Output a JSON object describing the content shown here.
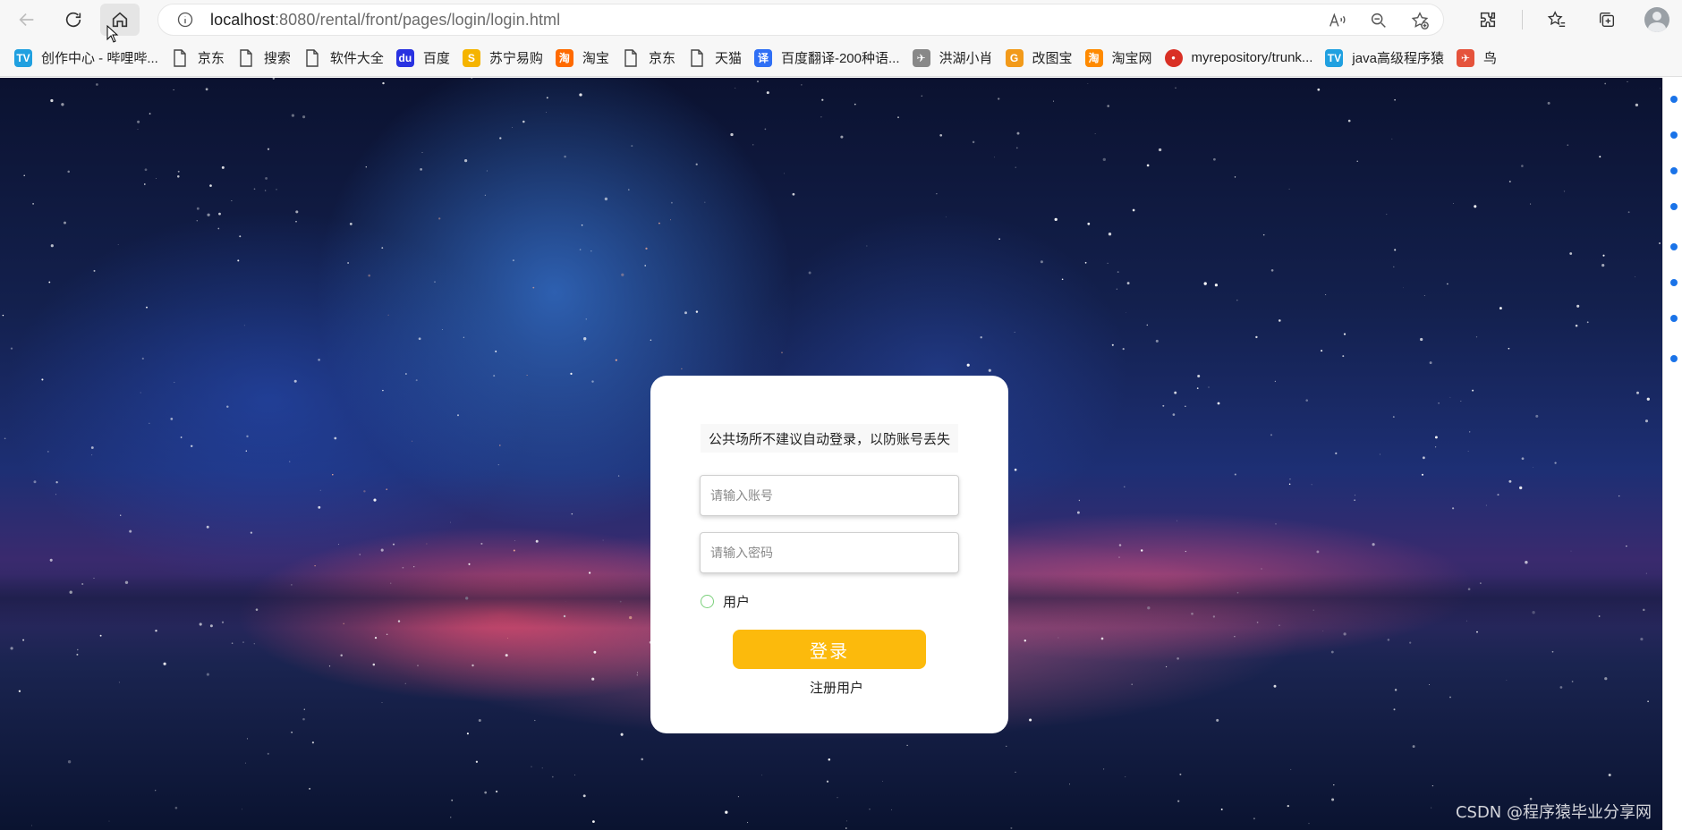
{
  "browser": {
    "url_host": "localhost",
    "url_rest": ":8080/rental/front/pages/login/login.html"
  },
  "bookmarks": [
    {
      "label": "创作中心 - 哔哩哔...",
      "icon": "bilibili-icon",
      "color": "#20a0e0"
    },
    {
      "label": "京东",
      "icon": "page-icon"
    },
    {
      "label": "搜索",
      "icon": "page-icon"
    },
    {
      "label": "软件大全",
      "icon": "page-icon"
    },
    {
      "label": "百度",
      "icon": "baidu-icon",
      "color": "#2932e1"
    },
    {
      "label": "苏宁易购",
      "icon": "suning-icon",
      "color": "#f5b400"
    },
    {
      "label": "淘宝",
      "icon": "taobao-icon",
      "color": "#ff6a00"
    },
    {
      "label": "京东",
      "icon": "page-icon"
    },
    {
      "label": "天猫",
      "icon": "page-icon"
    },
    {
      "label": "百度翻译-200种语...",
      "icon": "translate-icon",
      "color": "#2f6ff5"
    },
    {
      "label": "洪湖小肖",
      "icon": "bird-icon",
      "color": "#888888"
    },
    {
      "label": "改图宝",
      "icon": "gaitubao-icon",
      "color": "#f29a1a"
    },
    {
      "label": "淘宝网",
      "icon": "taobao-icon",
      "color": "#ff8a00"
    },
    {
      "label": "myrepository/trunk...",
      "icon": "chrome-icon",
      "color": "#d93025"
    },
    {
      "label": "java高级程序猿",
      "icon": "bilibili-icon",
      "color": "#20a0e0"
    },
    {
      "label": "鸟",
      "icon": "bird-icon",
      "color": "#e5533c"
    }
  ],
  "login": {
    "notice": "公共场所不建议自动登录，以防账号丢失",
    "account_placeholder": "请输入账号",
    "password_placeholder": "请输入密码",
    "role_label": "用户",
    "login_button": "登录",
    "register_link": "注册用户"
  },
  "colors": {
    "login_button": "#fcba0c",
    "radio_border": "#7bd07b"
  },
  "watermark": "CSDN @程序猿毕业分享网"
}
